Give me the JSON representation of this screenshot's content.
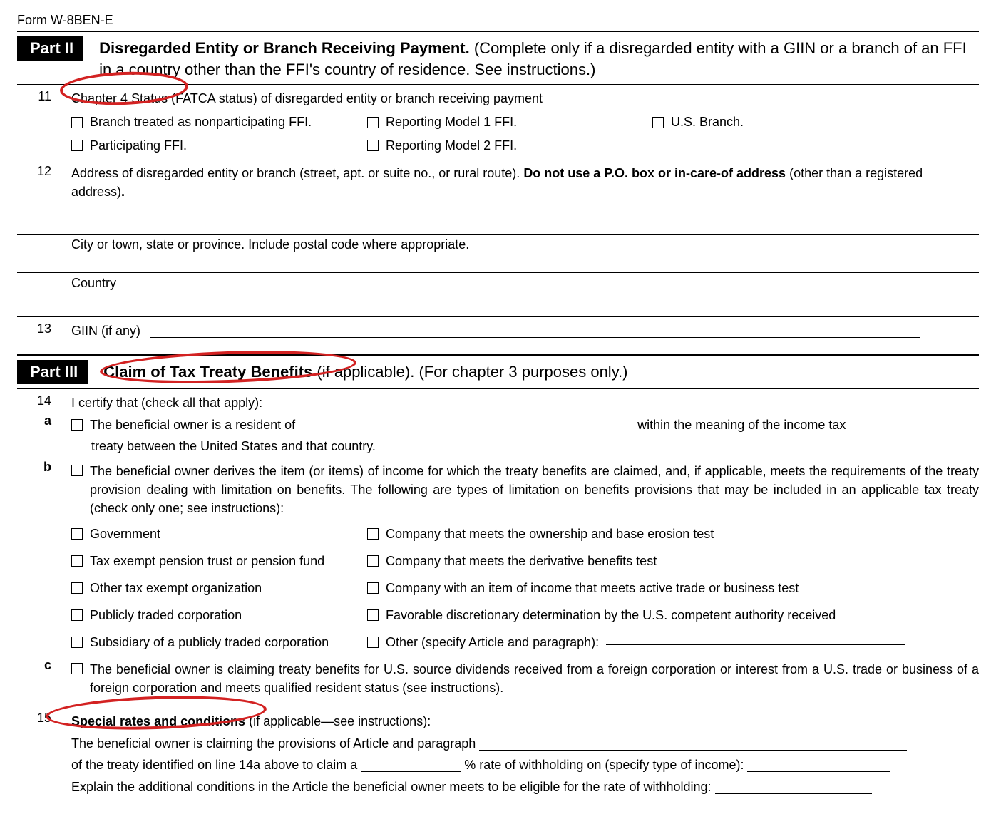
{
  "form_title": "Form W-8BEN-E",
  "part2": {
    "label": "Part II",
    "title_bold": "Disregarded Entity or Branch Receiving Payment.",
    "title_rest": " (Complete only if a disregarded entity with a GIIN or a branch of an FFI in a country other than the FFI's country of residence. See instructions.)"
  },
  "line11": {
    "num": "11",
    "text": "Chapter 4 Status (FATCA status) of disregarded entity or branch receiving payment",
    "options": {
      "a": "Branch treated as nonparticipating FFI.",
      "b": "Reporting Model 1 FFI.",
      "c": "U.S. Branch.",
      "d": "Participating FFI.",
      "e": "Reporting Model 2 FFI."
    }
  },
  "line12": {
    "num": "12",
    "text_a": "Address of disregarded entity or branch (street, apt. or suite no., or rural route). ",
    "text_bold": "Do not use a P.O. box or in-care-of address",
    "text_b": " (other than a registered address)",
    "city": "City or town, state or province. Include postal code where appropriate.",
    "country": "Country"
  },
  "line13": {
    "num": "13",
    "text": "GIIN (if any)"
  },
  "part3": {
    "label": "Part III",
    "title_bold": "Claim of Tax Treaty Benefits",
    "title_rest": " (if applicable). (For chapter 3 purposes only.)"
  },
  "line14": {
    "num": "14",
    "intro": "I certify that (check all that apply):",
    "a": {
      "label": "a",
      "pre": "The beneficial owner is a resident of ",
      "post": " within the meaning of the income tax",
      "line2": "treaty between the United States and that country."
    },
    "b": {
      "label": "b",
      "text": "The beneficial owner derives the item (or items) of income for which the treaty benefits are claimed, and, if applicable, meets the requirements of the treaty provision dealing with limitation on benefits. The following are types of limitation on benefits provisions that may be included in an applicable tax treaty (check only one; see instructions):"
    },
    "lob": {
      "gov": "Government",
      "own": "Company that meets the ownership and base erosion test",
      "pension": "Tax exempt pension trust or pension fund",
      "deriv": "Company that meets the derivative benefits test",
      "otherexempt": "Other tax exempt organization",
      "active": "Company with an item of income that meets active trade or business test",
      "public": "Publicly traded corporation",
      "favorable": "Favorable discretionary determination by the U.S. competent authority received",
      "subsidiary": "Subsidiary of a publicly traded corporation",
      "other": "Other (specify Article and paragraph):"
    },
    "c": {
      "label": "c",
      "text": "The beneficial owner is claiming treaty benefits for U.S. source dividends received from a foreign corporation or interest from a U.S. trade or business of a foreign corporation and meets qualified resident status (see instructions)."
    }
  },
  "line15": {
    "num": "15",
    "title_bold": "Special rates and conditions",
    "title_rest": " (if applicable—see instructions):",
    "l1": "The beneficial owner is claiming the provisions of Article and paragraph ",
    "l2a": "of the treaty identified on line 14a above to claim a ",
    "l2b": " % rate of withholding on (specify type of income): ",
    "l3": "Explain the additional conditions in the Article the beneficial owner meets to be eligible for the rate of withholding: "
  }
}
